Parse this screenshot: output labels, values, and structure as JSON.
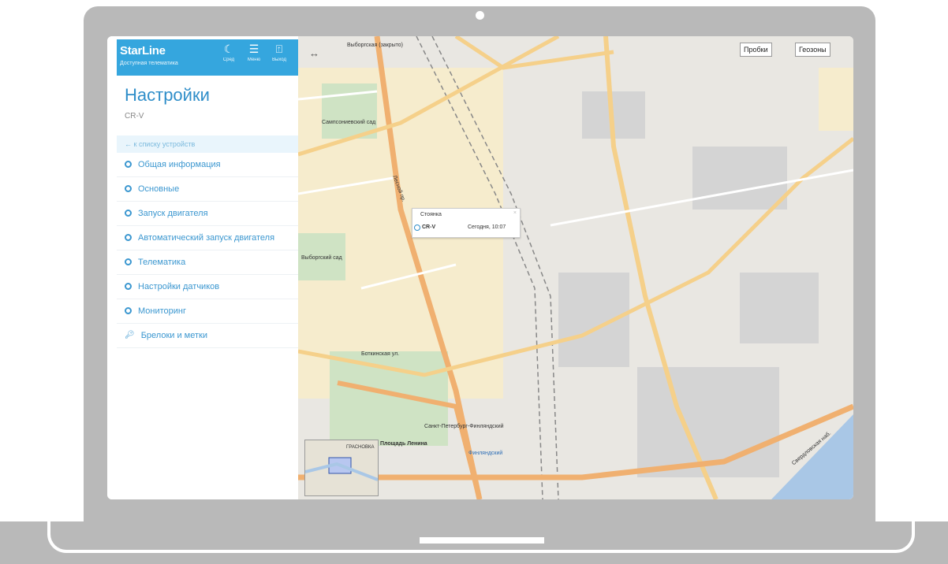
{
  "header": {
    "brand": "StarLine",
    "brand_sub": "Доступная телематика",
    "buttons": [
      {
        "icon": "moon-icon",
        "label": "Сред"
      },
      {
        "icon": "menu-icon",
        "label": "Меню"
      },
      {
        "icon": "exit-icon",
        "label": "Выход"
      }
    ]
  },
  "page": {
    "title": "Настройки",
    "subtitle": "CR-V"
  },
  "menu": {
    "back_label": "← к списку устройств",
    "items": [
      {
        "label": "Общая информация",
        "icon": "gear-icon"
      },
      {
        "label": "Основные",
        "icon": "gear-icon"
      },
      {
        "label": "Запуск двигателя",
        "icon": "gear-icon"
      },
      {
        "label": "Автоматический запуск двигателя",
        "icon": "gear-icon"
      },
      {
        "label": "Телематика",
        "icon": "gear-icon"
      },
      {
        "label": "Настройки датчиков",
        "icon": "gear-icon"
      },
      {
        "label": "Мониторинг",
        "icon": "gear-icon"
      },
      {
        "label": "Брелоки и метки",
        "icon": "key-icon"
      }
    ]
  },
  "map": {
    "buttons": [
      "Пробки",
      "Геозоны"
    ],
    "popup": {
      "header": "Стоянка",
      "car": "CR-V",
      "time": "Сегодня, 10:07"
    },
    "labels": {
      "vyborgskaya": "Выборгская (закрыто)",
      "sampson": "Сампсониевский сад",
      "vyborgsky": "Выборгский сад",
      "botkin": "Боткинская ул.",
      "lesnaya": "Лесной пр.",
      "station": "Санкт-Петербург-Финляндский",
      "lenin_sq": "Площадь Ленина",
      "finland": "Финляндский",
      "sverdlov": "Свердловская наб.",
      "minimap_label": "ГРАСНОВКА"
    }
  }
}
